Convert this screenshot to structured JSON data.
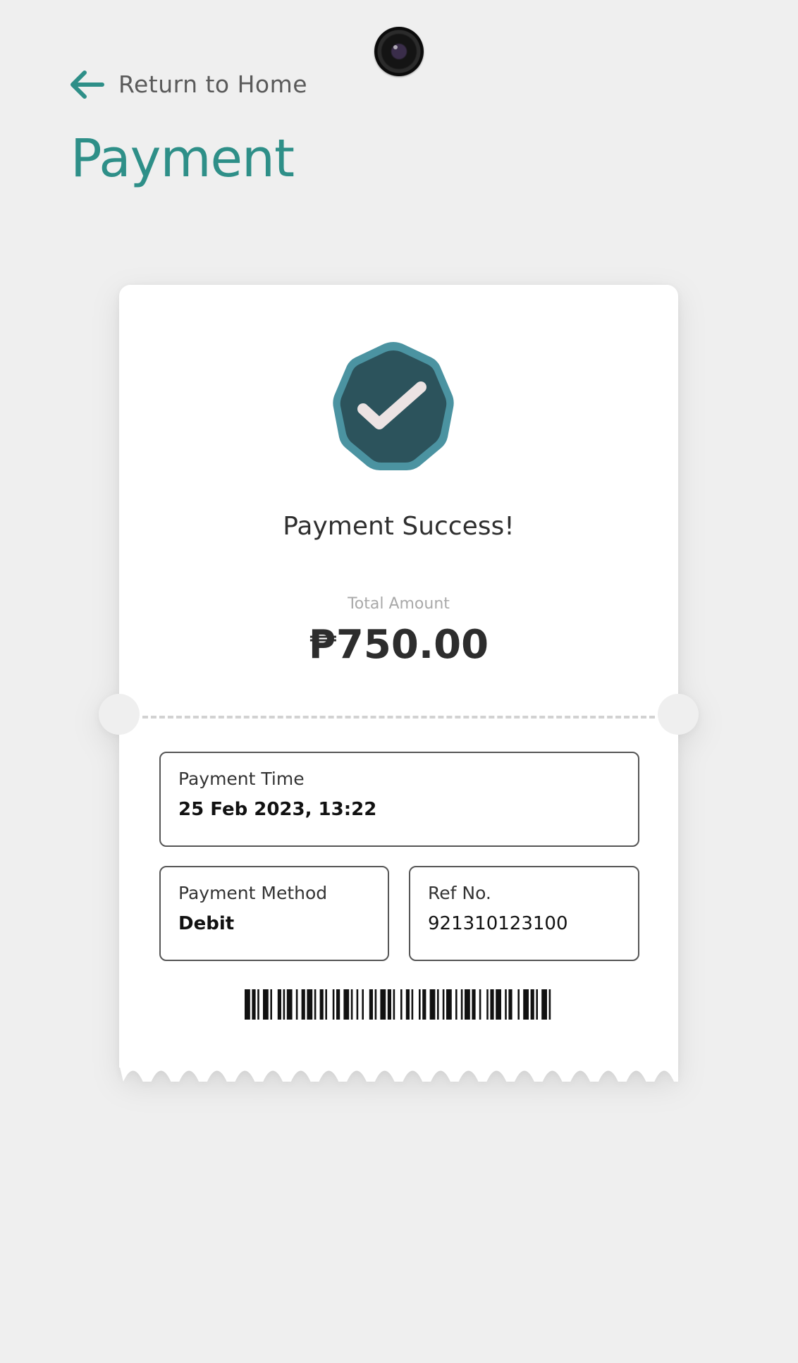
{
  "nav": {
    "back_label": "Return to Home"
  },
  "page": {
    "title": "Payment"
  },
  "receipt": {
    "status": "Payment Success!",
    "total_label": "Total Amount",
    "total_amount": "₱750.00",
    "payment_time_label": "Payment Time",
    "payment_time_value": "25 Feb 2023, 13:22",
    "payment_method_label": "Payment Method",
    "payment_method_value": "Debit",
    "ref_label": "Ref No.",
    "ref_value": "921310123100"
  },
  "colors": {
    "accent": "#2e8f88",
    "seal_outer": "#4b93a1",
    "seal_inner": "#2c535c",
    "background": "#efefef"
  },
  "icons": {
    "back": "arrow-left-icon",
    "status": "check-badge-icon",
    "barcode": "barcode-icon"
  }
}
